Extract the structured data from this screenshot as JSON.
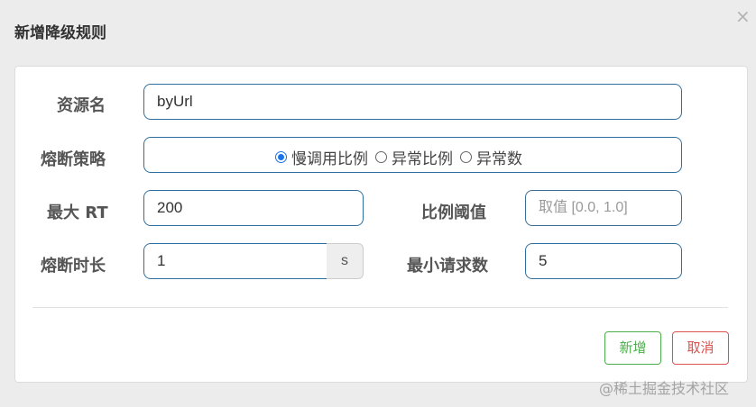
{
  "dialog": {
    "title": "新增降级规则",
    "close": "×"
  },
  "form": {
    "resource": {
      "label": "资源名",
      "value": "byUrl"
    },
    "strategy": {
      "label": "熔断策略",
      "options": [
        {
          "label": "慢调用比例",
          "checked": true
        },
        {
          "label": "异常比例",
          "checked": false
        },
        {
          "label": "异常数",
          "checked": false
        }
      ]
    },
    "max_rt": {
      "label": "最大 RT",
      "value": "200"
    },
    "ratio_threshold": {
      "label": "比例阈值",
      "placeholder": "取值 [0.0, 1.0]"
    },
    "duration": {
      "label": "熔断时长",
      "value": "1",
      "unit": "s"
    },
    "min_requests": {
      "label": "最小请求数",
      "value": "5"
    }
  },
  "footer": {
    "add_label": "新增",
    "cancel_label": "取消"
  },
  "watermark": "@稀土掘金技术社区"
}
